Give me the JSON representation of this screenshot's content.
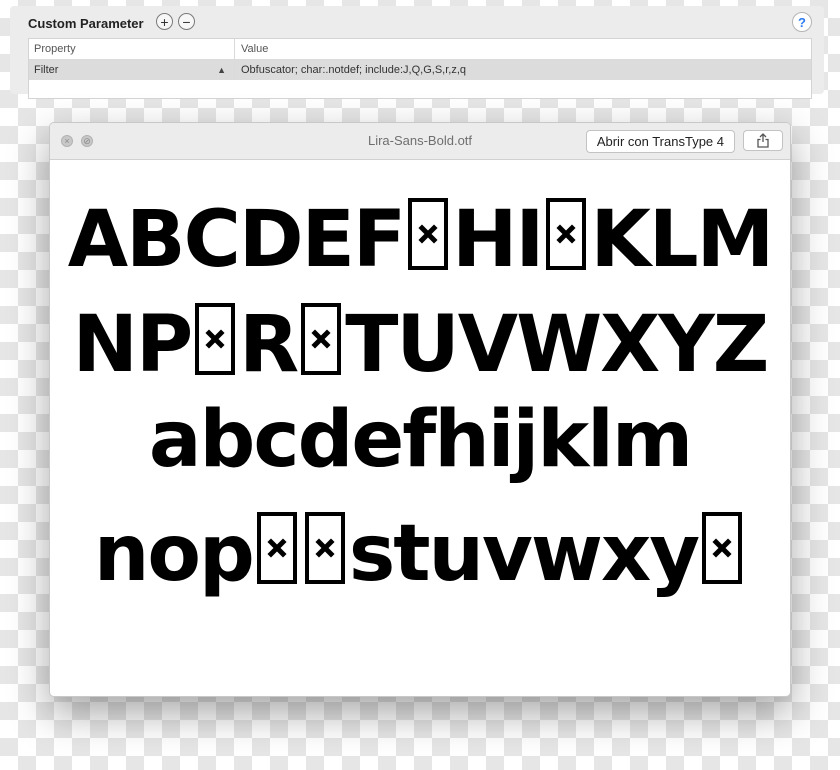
{
  "param_panel": {
    "title": "Custom Parameter",
    "add_icon": "plus-icon",
    "remove_icon": "minus-icon",
    "help_label": "?",
    "columns": [
      "Property",
      "Value"
    ],
    "rows": [
      {
        "property": "Filter",
        "value": "Obfuscator; char:.notdef; include:J,Q,G,S,r,z,q"
      }
    ]
  },
  "preview_window": {
    "title": "Lira-Sans-Bold.otf",
    "open_button": "Abrir con TransType 4",
    "share_icon": "share-icon",
    "close_icon": "close-icon",
    "fullscreen_icon": "fullscreen-icon",
    "glyph_lines": [
      [
        {
          "t": "ABCDEF"
        },
        {
          "notdef": true
        },
        {
          "t": "HI"
        },
        {
          "notdef": true
        },
        {
          "t": "KLM"
        }
      ],
      [
        {
          "t": "NP"
        },
        {
          "notdef": true
        },
        {
          "t": "R"
        },
        {
          "notdef": true
        },
        {
          "t": "TUVWXYZ"
        }
      ],
      [
        {
          "t": "abcdefhijklm"
        }
      ],
      [
        {
          "t": "nop"
        },
        {
          "notdef": true
        },
        {
          "notdef": true
        },
        {
          "t": "stuvwxy"
        },
        {
          "notdef": true
        }
      ]
    ]
  }
}
